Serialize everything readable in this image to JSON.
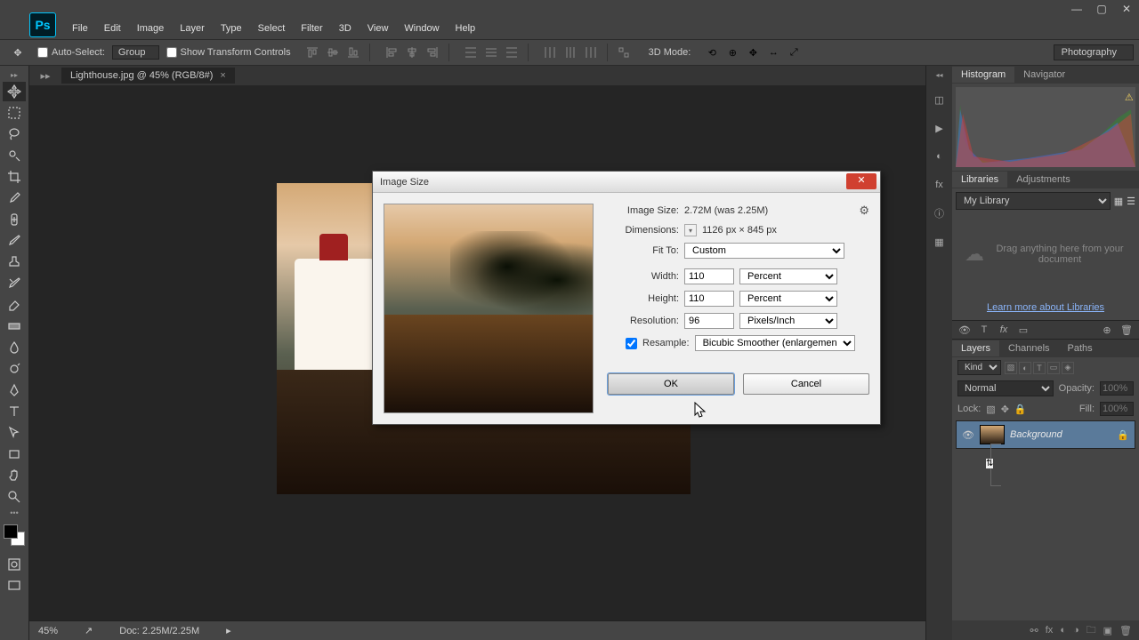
{
  "menu": [
    "File",
    "Edit",
    "Image",
    "Layer",
    "Type",
    "Select",
    "Filter",
    "3D",
    "View",
    "Window",
    "Help"
  ],
  "options": {
    "autoselect": "Auto-Select:",
    "layer_mode": "Group",
    "showtransform": "Show Transform Controls",
    "mode3d": "3D Mode:",
    "workspace": "Photography"
  },
  "doc": {
    "tab": "Lighthouse.jpg @ 45% (RGB/8#)",
    "zoom": "45%",
    "docsize": "Doc: 2.25M/2.25M"
  },
  "panels": {
    "histogram": "Histogram",
    "navigator": "Navigator",
    "libraries": "Libraries",
    "adjustments": "Adjustments",
    "layers": "Layers",
    "channels": "Channels",
    "paths": "Paths",
    "mylib": "My Library",
    "libdrop": "Drag anything here from your document",
    "liblink": "Learn more about Libraries",
    "kind": "Kind",
    "blend": "Normal",
    "opacity_label": "Opacity:",
    "opacity": "100%",
    "lock_label": "Lock:",
    "fill_label": "Fill:",
    "fill": "100%",
    "layer_bg": "Background"
  },
  "dialog": {
    "title": "Image Size",
    "size_label": "Image Size:",
    "size_value": "2.72M (was 2.25M)",
    "dim_label": "Dimensions:",
    "dim_value": "1126 px × 845 px",
    "fitto_label": "Fit To:",
    "fitto": "Custom",
    "width_label": "Width:",
    "width": "110",
    "width_unit": "Percent",
    "height_label": "Height:",
    "height": "110",
    "height_unit": "Percent",
    "res_label": "Resolution:",
    "res": "96",
    "res_unit": "Pixels/Inch",
    "resample_label": "Resample:",
    "resample": "Bicubic Smoother (enlargement)",
    "ok": "OK",
    "cancel": "Cancel"
  }
}
